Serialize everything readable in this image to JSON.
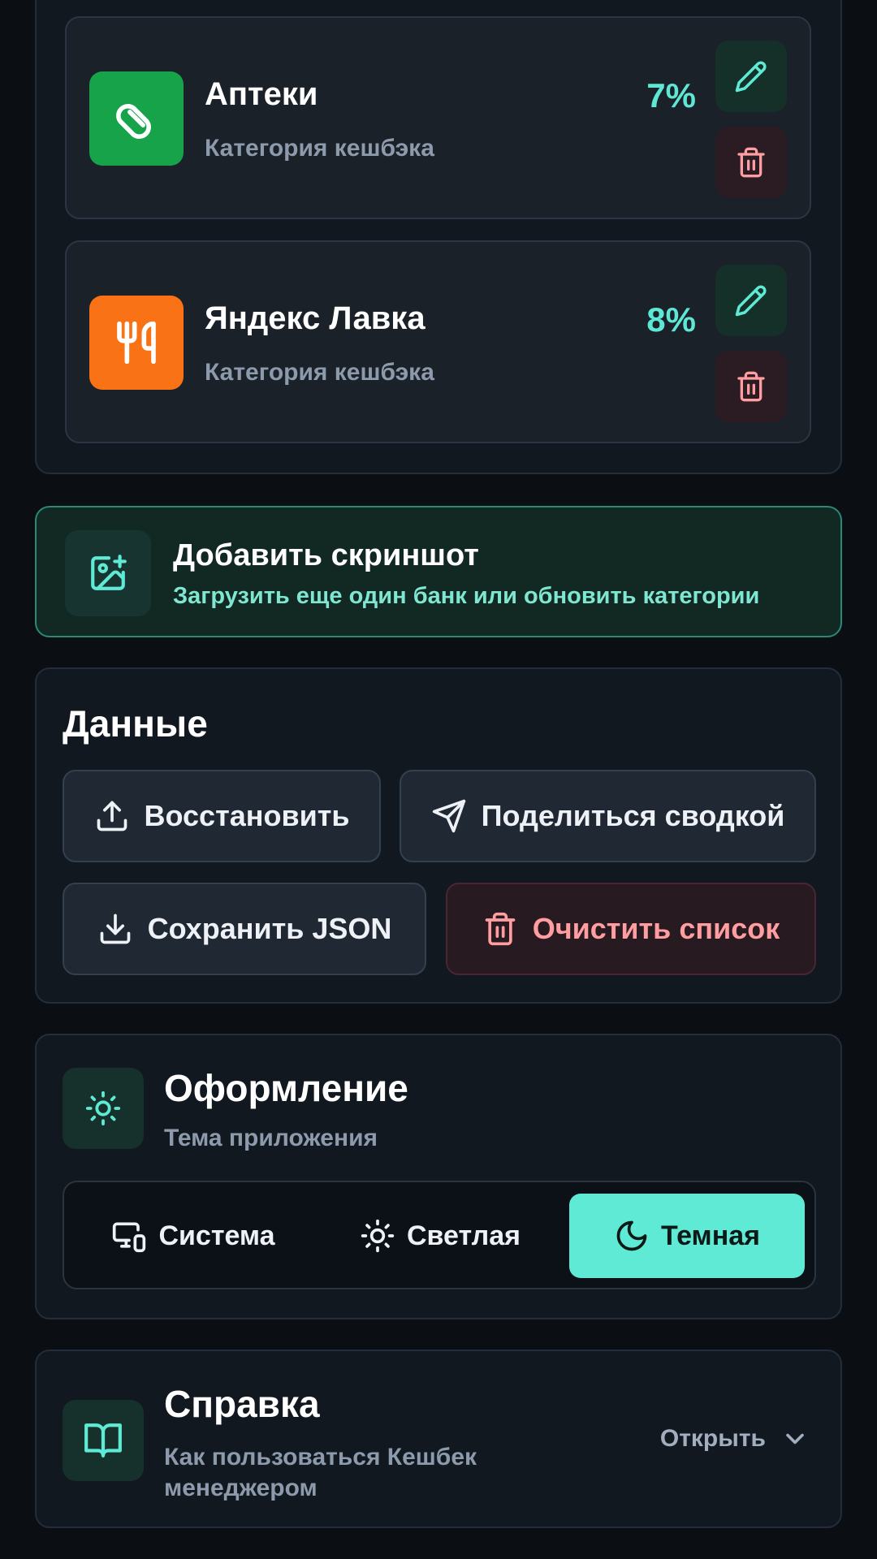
{
  "categories": [
    {
      "name": "Аптеки",
      "subtitle": "Категория кешбэка",
      "percent": "7%",
      "icon": "pill-icon",
      "color": "#16a34a"
    },
    {
      "name": "Яндекс Лавка",
      "subtitle": "Категория кешбэка",
      "percent": "8%",
      "icon": "fork-knife-icon",
      "color": "#f97316"
    }
  ],
  "add_screenshot": {
    "title": "Добавить скриншот",
    "subtitle": "Загрузить еще один банк или обновить категории",
    "icon": "image-plus-icon"
  },
  "data_section": {
    "title": "Данные",
    "restore": "Восстановить",
    "share": "Поделиться сводкой",
    "save_json": "Сохранить JSON",
    "clear": "Очистить список"
  },
  "theme_section": {
    "title": "Оформление",
    "subtitle": "Тема приложения",
    "options": [
      {
        "label": "Система",
        "icon": "monitor-phone-icon",
        "active": false
      },
      {
        "label": "Светлая",
        "icon": "sun-icon",
        "active": false
      },
      {
        "label": "Темная",
        "icon": "moon-icon",
        "active": true
      }
    ]
  },
  "help_section": {
    "title": "Справка",
    "subtitle": "Как пользоваться Кешбек менеджером",
    "open_label": "Открыть",
    "icon": "book-icon"
  },
  "colors": {
    "accent": "#5eead4",
    "danger": "#ff9da1",
    "background": "#0b0f14"
  }
}
